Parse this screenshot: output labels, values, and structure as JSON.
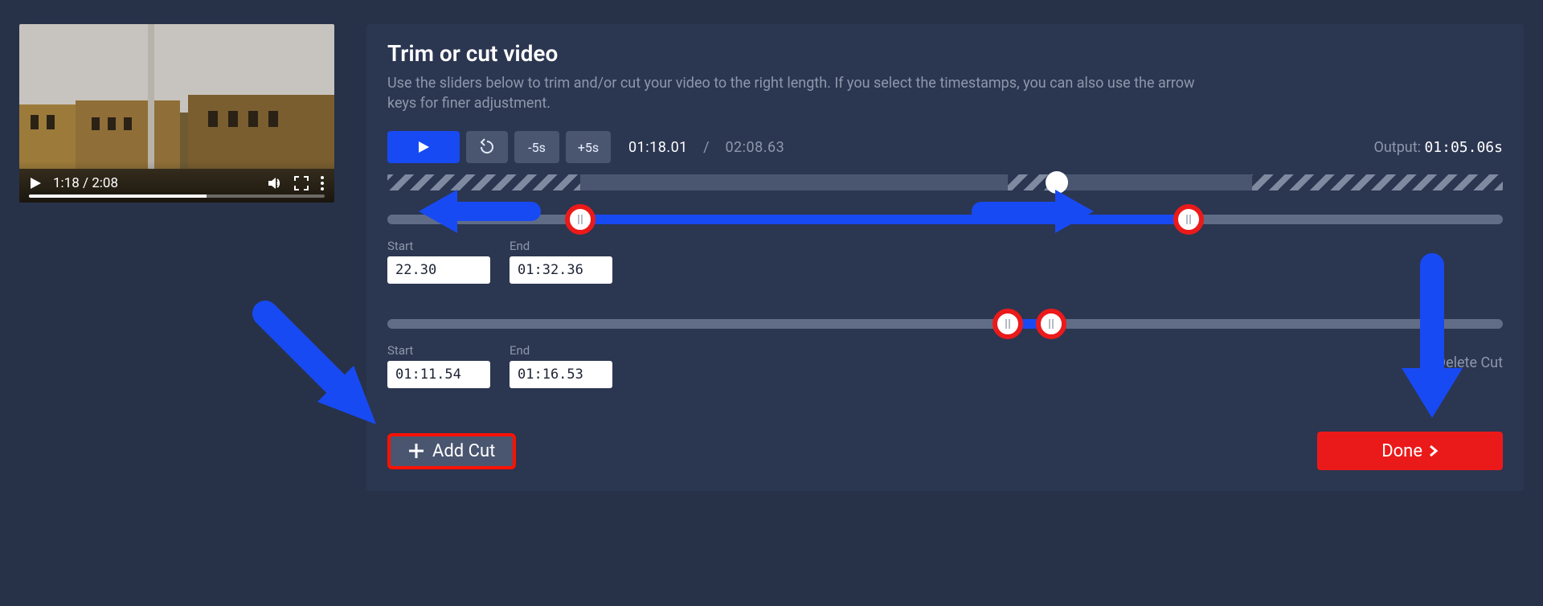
{
  "video_player": {
    "time_display": "1:18 / 2:08",
    "progress_pct": 60
  },
  "header": {
    "title": "Trim or cut video",
    "description": "Use the sliders below to trim and/or cut your video to the right length. If you select the timestamps, you can also use the arrow keys for finer adjustment."
  },
  "toolbar": {
    "play": "▶",
    "rewind_icon": "↺",
    "minus5": "-5s",
    "plus5": "+5s",
    "current_time": "01:18.01",
    "duration": "02:08.63",
    "output_label": "Output: ",
    "output_value": "01:05.06s"
  },
  "trim": {
    "start_label": "Start",
    "end_label": "End",
    "start_value": "22.30",
    "end_value": "01:32.36"
  },
  "cut": {
    "start_label": "Start",
    "end_label": "End",
    "start_value": "01:11.54",
    "end_value": "01:16.53",
    "delete_label": "Delete Cut"
  },
  "footer": {
    "add_cut": "Add Cut",
    "done": "Done"
  }
}
